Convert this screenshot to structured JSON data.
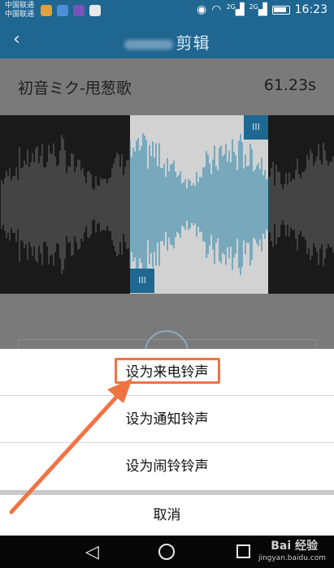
{
  "status": {
    "carrier1": "中国联通",
    "carrier2": "中国联通",
    "signal_label_1": "2G",
    "signal_label_2": "2G",
    "time": "16:23"
  },
  "header": {
    "title": "剪辑"
  },
  "song": {
    "title": "初音ミク-甩葱歌",
    "duration": "61.23s"
  },
  "handles": {
    "top_label": "III",
    "bottom_label": "III"
  },
  "action_sheet": {
    "items": [
      {
        "label": "设为来电铃声"
      },
      {
        "label": "设为通知铃声"
      },
      {
        "label": "设为闹铃铃声"
      }
    ],
    "cancel_label": "取消"
  },
  "watermark": {
    "logo": "Bai 经验",
    "url": "jingyan.baidu.com"
  },
  "colors": {
    "accent": "#1f6691",
    "wave_selected": "#1e7fa5",
    "wave_unselected": "#6e6e6e",
    "highlight": "#f07342"
  }
}
